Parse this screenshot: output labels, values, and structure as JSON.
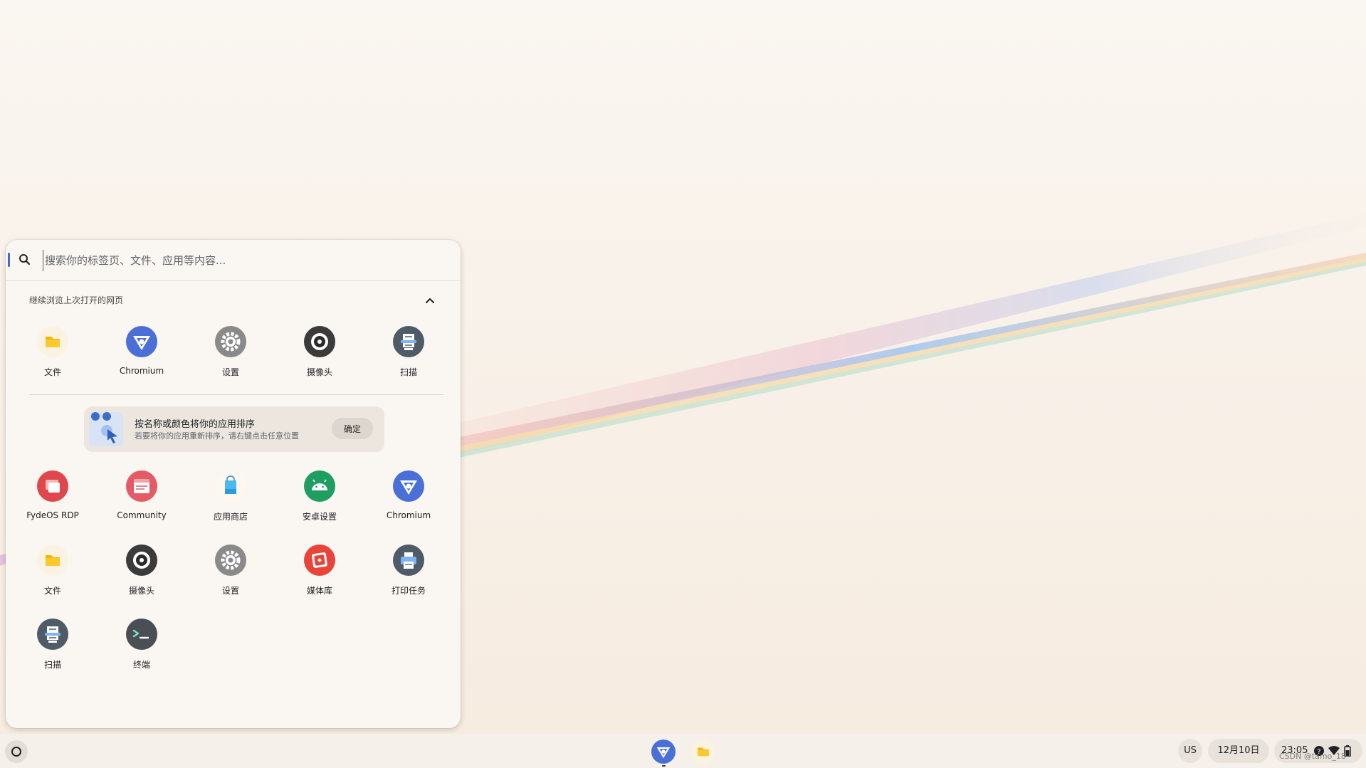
{
  "search": {
    "placeholder": "搜索你的标签页、文件、应用等内容..."
  },
  "continue_section": {
    "title": "继续浏览上次打开的网页",
    "apps": [
      {
        "label": "文件",
        "icon": "files-icon"
      },
      {
        "label": "Chromium",
        "icon": "chromium-icon"
      },
      {
        "label": "设置",
        "icon": "settings-gear-icon"
      },
      {
        "label": "摄像头",
        "icon": "camera-icon"
      },
      {
        "label": "扫描",
        "icon": "scan-icon"
      }
    ]
  },
  "nudge": {
    "title": "按名称或颜色将你的应用排序",
    "subtitle": "若要将你的应用重新排序，请右键点击任意位置",
    "button": "确定"
  },
  "apps": [
    {
      "label": "FydeOS RDP",
      "icon": "fydeos-rdp-icon"
    },
    {
      "label": "Community",
      "icon": "community-icon"
    },
    {
      "label": "应用商店",
      "icon": "app-store-icon"
    },
    {
      "label": "安卓设置",
      "icon": "android-settings-icon"
    },
    {
      "label": "Chromium",
      "icon": "chromium-icon"
    },
    {
      "label": "文件",
      "icon": "files-icon"
    },
    {
      "label": "摄像头",
      "icon": "camera-icon"
    },
    {
      "label": "设置",
      "icon": "settings-gear-icon"
    },
    {
      "label": "媒体库",
      "icon": "gallery-icon"
    },
    {
      "label": "打印任务",
      "icon": "print-jobs-icon"
    },
    {
      "label": "扫描",
      "icon": "scan-icon"
    },
    {
      "label": "终端",
      "icon": "terminal-icon"
    }
  ],
  "shelf": {
    "pinned": [
      {
        "name": "Chromium",
        "icon": "chromium-icon"
      },
      {
        "name": "文件",
        "icon": "files-icon"
      }
    ],
    "ime": "US",
    "date": "12月10日",
    "time": "23:05"
  },
  "watermark": "CSDN @tamo_18",
  "colors": {
    "chromium_blue": "#4a6fd6",
    "files_yellow": "#f5b400",
    "settings_gray": "#8a8a8a",
    "camera_dark": "#3b3b3b",
    "scan_slate": "#4f5b66",
    "rdp_red": "#e0474c",
    "android_green": "#1e9e62",
    "gallery_red": "#e8443a"
  }
}
